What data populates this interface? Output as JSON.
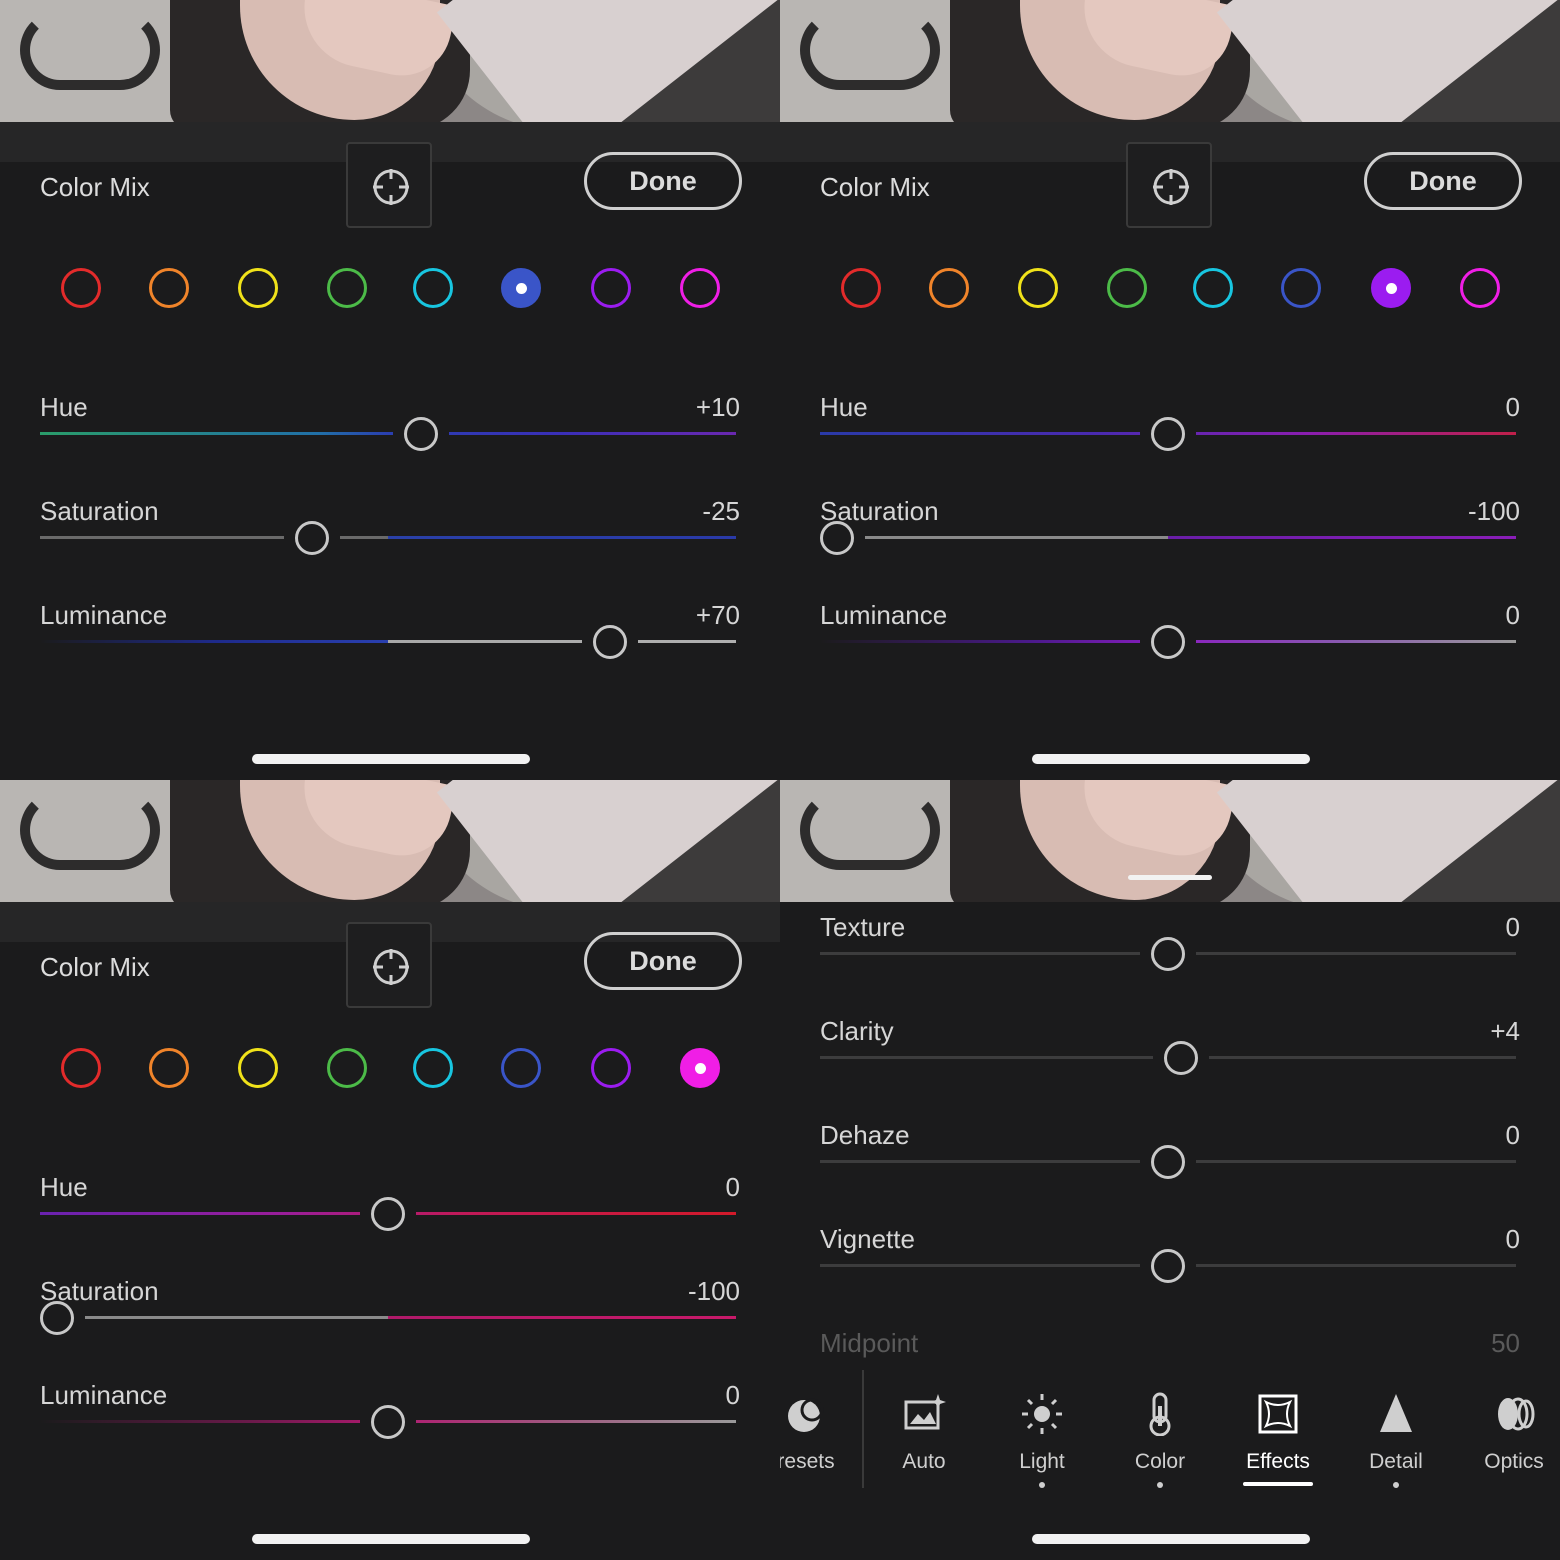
{
  "panels": [
    {
      "title": "Color Mix",
      "done_label": "Done",
      "selected_swatch": 5,
      "sliders": [
        {
          "label": "Hue",
          "value": "+10",
          "pos": 0.55
        },
        {
          "label": "Saturation",
          "value": "-25",
          "pos": 0.385
        },
        {
          "label": "Luminance",
          "value": "+70",
          "pos": 0.835
        }
      ]
    },
    {
      "title": "Color Mix",
      "done_label": "Done",
      "selected_swatch": 6,
      "sliders": [
        {
          "label": "Hue",
          "value": "0",
          "pos": 0.5
        },
        {
          "label": "Saturation",
          "value": "-100",
          "pos": 0.0
        },
        {
          "label": "Luminance",
          "value": "0",
          "pos": 0.5
        }
      ]
    },
    {
      "title": "Color Mix",
      "done_label": "Done",
      "selected_swatch": 7,
      "sliders": [
        {
          "label": "Hue",
          "value": "0",
          "pos": 0.5
        },
        {
          "label": "Saturation",
          "value": "-100",
          "pos": 0.0
        },
        {
          "label": "Luminance",
          "value": "0",
          "pos": 0.5
        }
      ]
    }
  ],
  "swatch_colors": [
    "#e32b2b",
    "#f0842a",
    "#f0e21a",
    "#4cbb48",
    "#18c6e0",
    "#3a55c8",
    "#9b1cf0",
    "#f01ee6"
  ],
  "effects": {
    "sliders": [
      {
        "label": "Texture",
        "value": "0",
        "pos": 0.5
      },
      {
        "label": "Clarity",
        "value": "+4",
        "pos": 0.52
      },
      {
        "label": "Dehaze",
        "value": "0",
        "pos": 0.5
      },
      {
        "label": "Vignette",
        "value": "0",
        "pos": 0.5
      }
    ],
    "faded": {
      "label": "Midpoint",
      "value": "50"
    },
    "toolbar": [
      {
        "label": "resets",
        "icon": "presets-icon",
        "dot": false,
        "active": false
      },
      {
        "label": "Auto",
        "icon": "auto-icon",
        "dot": false,
        "active": false
      },
      {
        "label": "Light",
        "icon": "light-icon",
        "dot": true,
        "active": false
      },
      {
        "label": "Color",
        "icon": "color-icon",
        "dot": true,
        "active": false
      },
      {
        "label": "Effects",
        "icon": "effects-icon",
        "dot": false,
        "active": true
      },
      {
        "label": "Detail",
        "icon": "detail-icon",
        "dot": true,
        "active": false
      },
      {
        "label": "Optics",
        "icon": "optics-icon",
        "dot": false,
        "active": false
      }
    ]
  }
}
